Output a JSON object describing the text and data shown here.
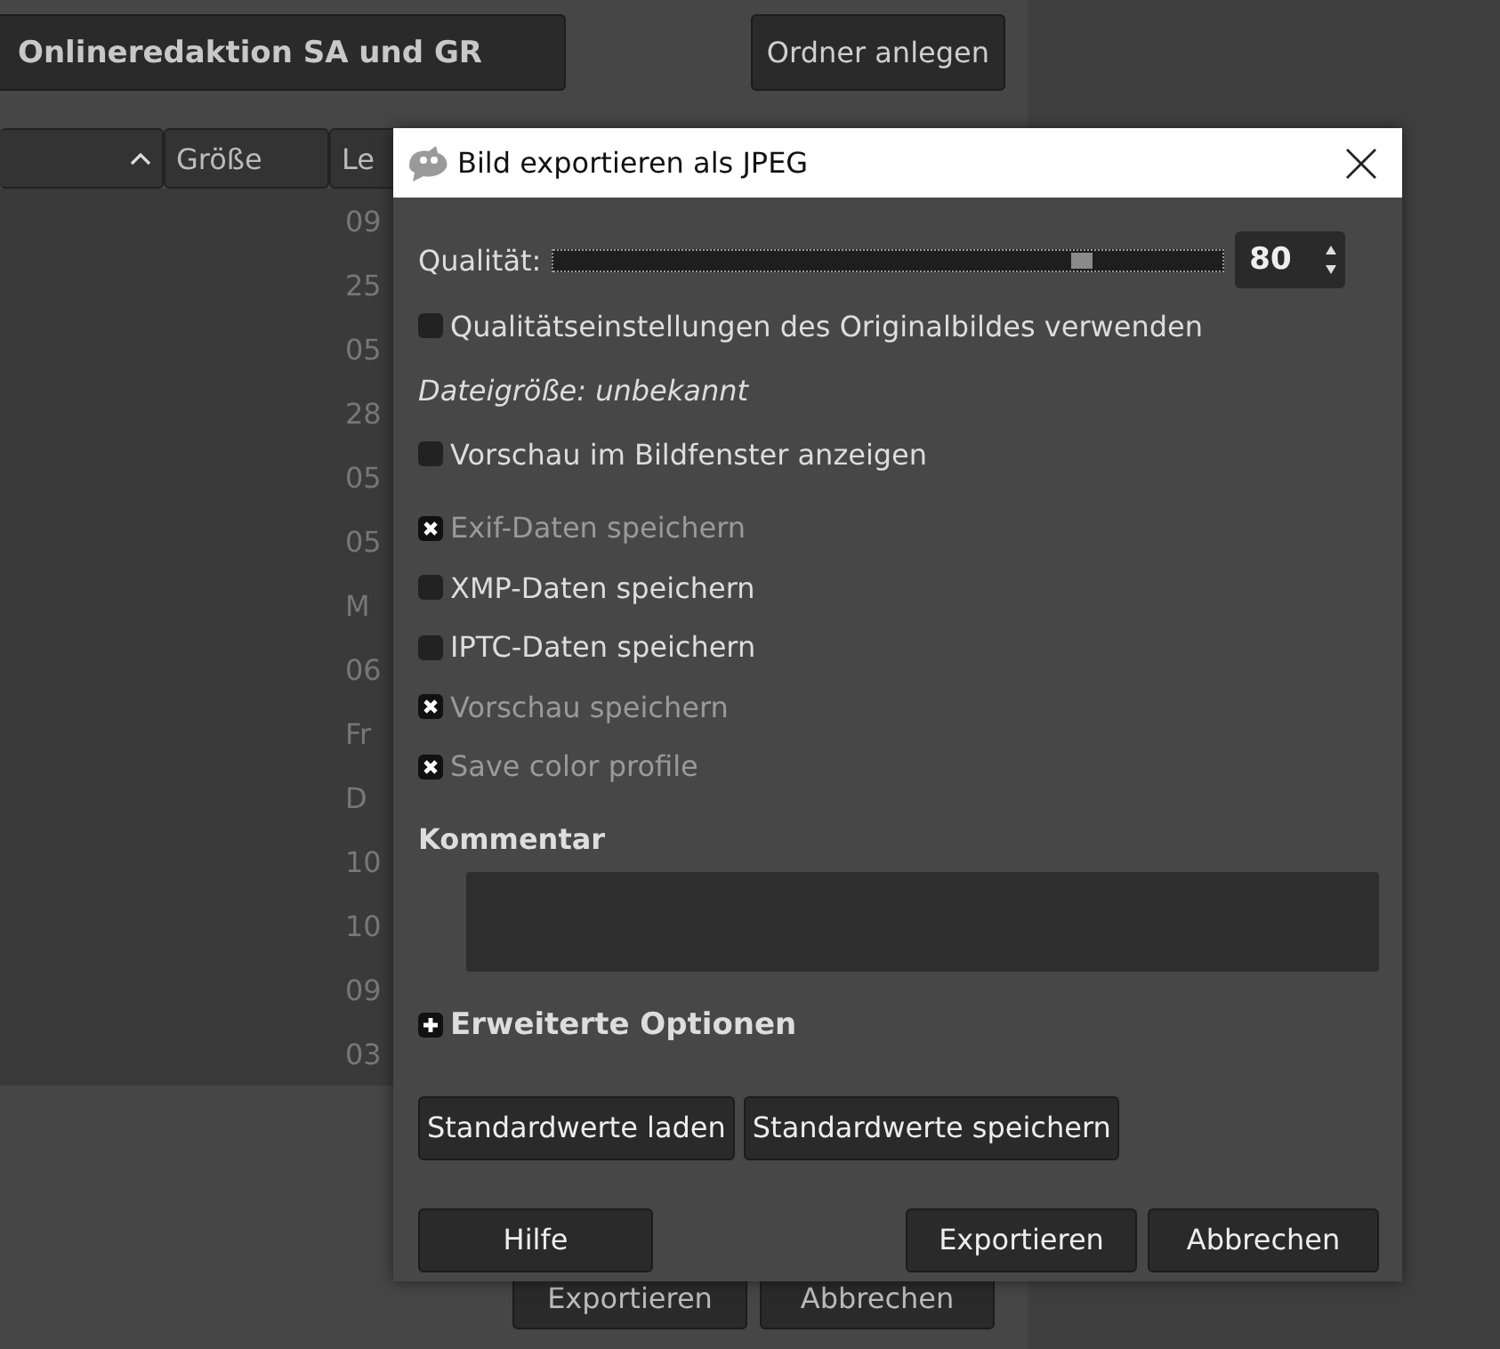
{
  "background": {
    "path_button": "Onlineredaktion SA und GR",
    "new_folder_button": "Ordner anlegen",
    "columns": [
      {
        "sorted": true
      },
      {
        "label": "Größe",
        "sorted": false
      },
      {
        "label": "Le",
        "sorted": false
      }
    ],
    "column_3_cells": [
      "09",
      "25",
      "05",
      "28",
      "05",
      "05",
      "M",
      "06",
      "Fr",
      "D",
      "10",
      "10",
      "09",
      "03"
    ],
    "buttons": [
      "Exportieren",
      "Abbrechen"
    ]
  },
  "dialog": {
    "title": "Bild exportieren als JPEG",
    "quality": {
      "label": "Qualität:",
      "level": 0.8,
      "value": "80"
    },
    "options": [
      {
        "kind": "checkbox",
        "label": "Qualitätseinstellungen des Originalbildes verwenden",
        "checked": false,
        "disabled": false
      },
      {
        "kind": "info",
        "label": "Dateigröße: unbekannt"
      },
      {
        "kind": "checkbox",
        "label": "Vorschau im Bildfenster anzeigen",
        "checked": false,
        "disabled": false
      },
      {
        "kind": "checkbox",
        "label": "Exif-Daten speichern",
        "checked": true,
        "disabled": true
      },
      {
        "kind": "checkbox",
        "label": "XMP-Daten speichern",
        "checked": false,
        "disabled": false
      },
      {
        "kind": "checkbox",
        "label": "IPTC-Daten speichern",
        "checked": false,
        "disabled": false
      },
      {
        "kind": "checkbox",
        "label": "Vorschau speichern",
        "checked": true,
        "disabled": true
      },
      {
        "kind": "checkbox",
        "label": "Save color profile",
        "checked": true,
        "disabled": true
      }
    ],
    "comment": {
      "label": "Kommentar"
    },
    "advanced": {
      "label": "Erweiterte Optionen",
      "expanded": false
    },
    "defaults_buttons": [
      "Standardwerte laden",
      "Standardwerte speichern"
    ],
    "help_button": "Hilfe",
    "action_buttons": [
      "Exportieren",
      "Abbrechen"
    ]
  }
}
